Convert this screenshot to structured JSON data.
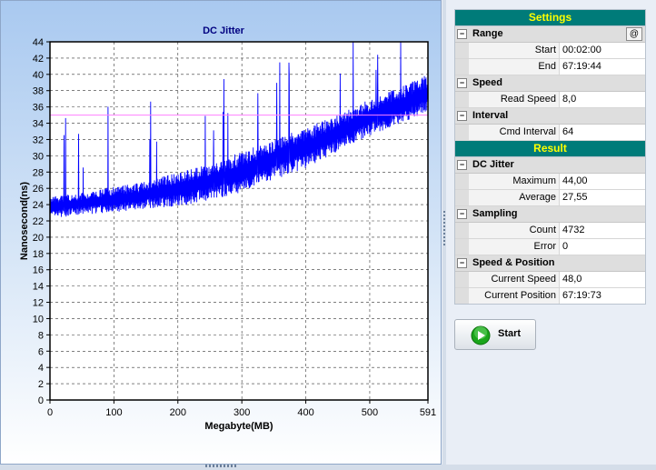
{
  "chart_data": {
    "type": "line",
    "title": "DC Jitter",
    "xlabel": "Megabyte(MB)",
    "ylabel": "Nanosecond(ns)",
    "xlim": [
      0,
      591
    ],
    "ylim": [
      0,
      44
    ],
    "x_ticks": [
      "0",
      "100",
      "200",
      "300",
      "400",
      "500",
      "591"
    ],
    "y_ticks": [
      "0",
      "2",
      "4",
      "6",
      "8",
      "10",
      "12",
      "14",
      "16",
      "18",
      "20",
      "22",
      "24",
      "26",
      "28",
      "30",
      "32",
      "34",
      "36",
      "38",
      "40",
      "42",
      "44"
    ],
    "grid": true,
    "threshold_line": 35,
    "series": [
      {
        "color": "#0000ff",
        "x": [
          0,
          50,
          100,
          150,
          200,
          250,
          300,
          350,
          400,
          450,
          500,
          550,
          591
        ],
        "y_low": [
          22.2,
          22.8,
          23.0,
          23.5,
          23.8,
          24.5,
          25.5,
          27.0,
          28.5,
          30.5,
          32.5,
          34.0,
          35.5
        ],
        "y_high": [
          25.0,
          25.5,
          26.2,
          26.8,
          28.0,
          29.0,
          30.5,
          32.0,
          33.5,
          35.0,
          37.0,
          38.5,
          40.0
        ]
      }
    ],
    "colors": {
      "line": "#0000ff",
      "threshold": "#ff80ff",
      "frame": "#000000",
      "tick_text": "#000000"
    }
  },
  "settings": {
    "header": "Settings",
    "range": {
      "label": "Range",
      "at_button": "@",
      "start_label": "Start",
      "start_value": "00:02:00",
      "end_label": "End",
      "end_value": "67:19:44"
    },
    "speed": {
      "label": "Speed",
      "read_speed_label": "Read Speed",
      "read_speed_value": "8,0"
    },
    "interval": {
      "label": "Interval",
      "cmd_interval_label": "Cmd Interval",
      "cmd_interval_value": "64"
    }
  },
  "result": {
    "header": "Result",
    "dc_jitter": {
      "label": "DC Jitter",
      "maximum_label": "Maximum",
      "maximum_value": "44,00",
      "average_label": "Average",
      "average_value": "27,55"
    },
    "sampling": {
      "label": "Sampling",
      "count_label": "Count",
      "count_value": "4732",
      "error_label": "Error",
      "error_value": "0"
    },
    "speed_position": {
      "label": "Speed & Position",
      "current_speed_label": "Current Speed",
      "current_speed_value": "48,0",
      "current_position_label": "Current Position",
      "current_position_value": "67:19:73"
    }
  },
  "toggle_symbol": "−",
  "start_button": {
    "label": "Start",
    "icon": "play-icon",
    "accent": "#1aa51a"
  },
  "accent_colors": {
    "banner": "#007b79",
    "banner_text": "#ffff00",
    "chart_title": "#000080"
  }
}
